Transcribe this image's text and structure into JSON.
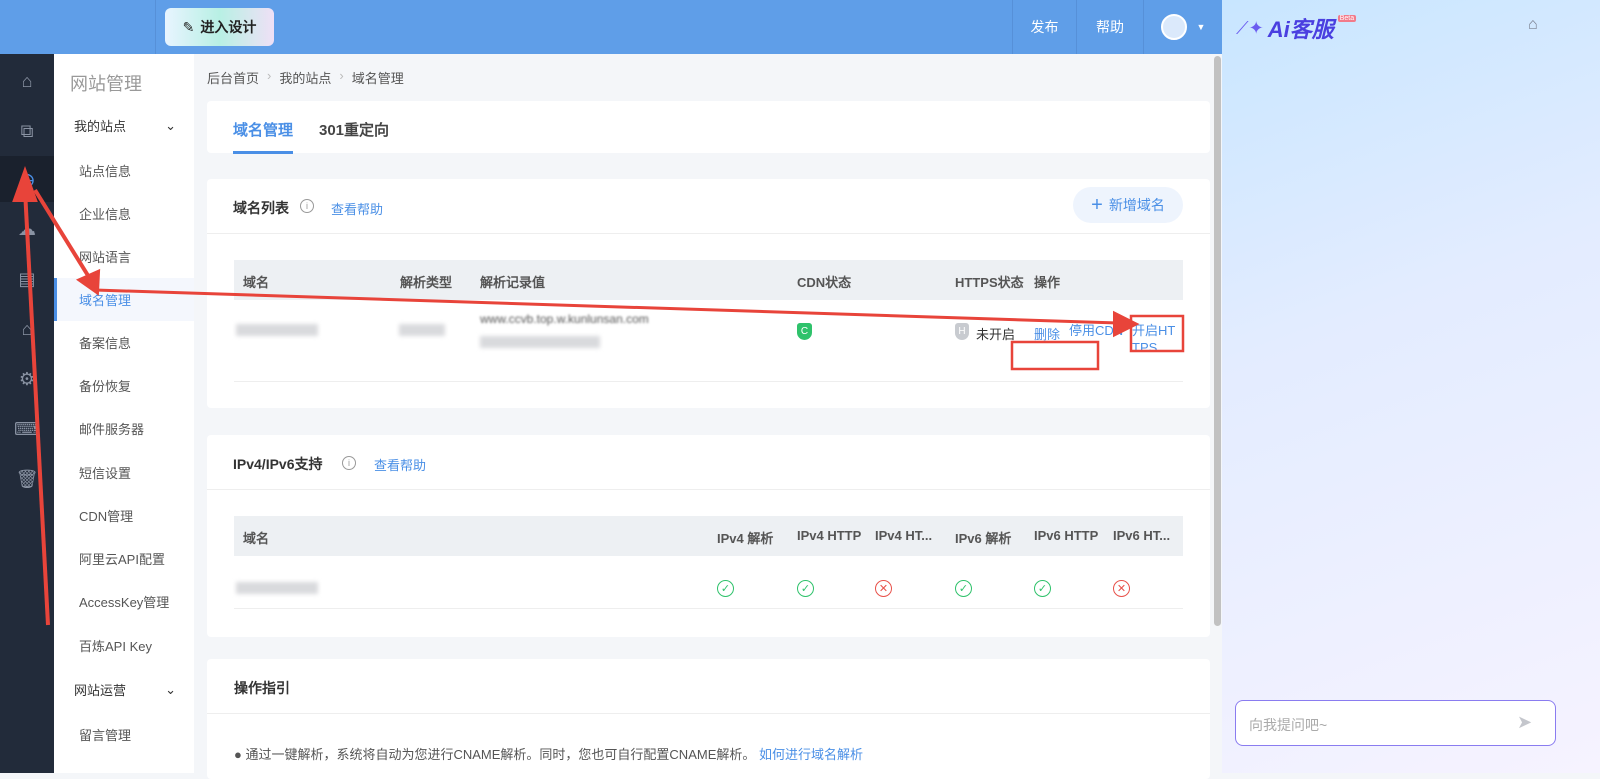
{
  "topbar": {
    "design_button": "进入设计",
    "publish": "发布",
    "help": "帮助"
  },
  "ai_panel": {
    "title": "Ai客服",
    "badge": "Beta",
    "input_placeholder": "向我提问吧~"
  },
  "subnav": {
    "title": "网站管理",
    "group1": "我的站点",
    "items": [
      "站点信息",
      "企业信息",
      "网站语言",
      "域名管理",
      "备案信息",
      "备份恢复",
      "邮件服务器",
      "短信设置",
      "CDN管理",
      "阿里云API配置",
      "AccessKey管理",
      "百炼API Key"
    ],
    "group2": "网站运营",
    "items2": [
      "留言管理"
    ]
  },
  "breadcrumb": [
    "后台首页",
    "我的站点",
    "域名管理"
  ],
  "tabs": [
    "域名管理",
    "301重定向"
  ],
  "domain_list": {
    "title": "域名列表",
    "help": "查看帮助",
    "add_button": "新增域名",
    "columns": [
      "域名",
      "解析类型",
      "解析记录值",
      "CDN状态",
      "HTTPS状态",
      "操作"
    ],
    "row": {
      "record": "www.ccvb.top.w.kunlunsan.com",
      "cdn_badge": "C",
      "https_badge": "H",
      "https_status": "未开启",
      "actions": [
        "删除",
        "停用CDN",
        "开启HTTPS"
      ]
    }
  },
  "ipv6": {
    "title": "IPv4/IPv6支持",
    "help": "查看帮助",
    "columns": [
      "域名",
      "IPv4 解析",
      "IPv4 HTTP",
      "IPv4 HT...",
      "IPv6 解析",
      "IPv6 HTTP",
      "IPv6 HT..."
    ],
    "row_status": [
      "ok",
      "ok",
      "bad",
      "ok",
      "ok",
      "bad"
    ]
  },
  "guide": {
    "title": "操作指引",
    "text": "通过一键解析，系统将自动为您进行CNAME解析。同时，您也可自行配置CNAME解析。",
    "link": "如何进行域名解析"
  }
}
